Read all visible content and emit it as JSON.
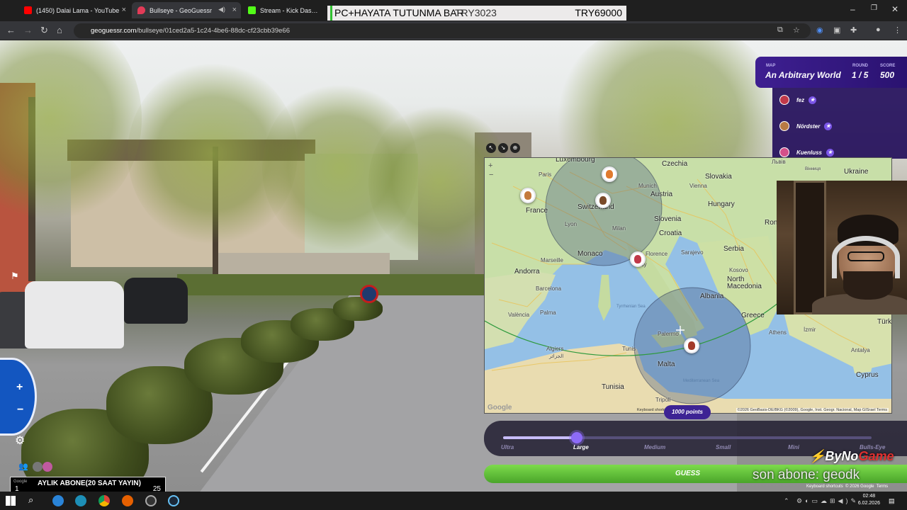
{
  "browser": {
    "tabs": [
      {
        "title": "(1450) Dalai Lama - YouTube",
        "color": "#ff0000"
      },
      {
        "title": "Bullseye - GeoGuessr",
        "color": "#e23b57"
      },
      {
        "title": "Stream - Kick Dashboard",
        "color": "#53fc18"
      }
    ],
    "url_site": "geoguessr.com",
    "url_path": "/bullseye/01ced2a5-1c24-4be6-88dc-cf23cbb39e66"
  },
  "stream_banner": {
    "left": "PC+HAYATA TUTUNMA BAR",
    "middle": "TRY3023",
    "right": "TRY69000"
  },
  "hud": {
    "map_label": "MAP",
    "map_name": "An Arbitrary World",
    "round_label": "ROUND",
    "round_value": "1 / 5",
    "score_label": "SCORE",
    "score_value": "500"
  },
  "players": [
    {
      "name": "fez",
      "avatar_color": "#c0394a"
    },
    {
      "name": "Nördster",
      "avatar_color": "#b97a44"
    },
    {
      "name": "Kuenluss",
      "avatar_color": "#d4508a"
    }
  ],
  "map": {
    "labels": {
      "luxembourg": "Luxembourg",
      "czechia": "Czechia",
      "slovakia": "Slovakia",
      "ukraine": "Ukraine",
      "lviv": "Львів",
      "vinnytsia": "Вінниця",
      "paris": "Paris",
      "munich": "Munich",
      "austria": "Austria",
      "vienna": "Vienna",
      "france": "France",
      "switzerland": "Switzerland",
      "hungary": "Hungary",
      "lyon": "Lyon",
      "milan": "Milan",
      "slovenia": "Slovenia",
      "croatia": "Croatia",
      "monaco": "Monaco",
      "sarajevo": "Sarajevo",
      "serbia": "Serbia",
      "marseille": "Marseille",
      "andorra": "Andorra",
      "florence": "Florence",
      "italy": "Italy",
      "kosovo": "Kosovo",
      "barcelona": "Barcelona",
      "north_macedonia": "North Macedonia",
      "albania": "Albania",
      "valencia": "València",
      "palma": "Palma",
      "tyrrhenian": "Tyrrhenian Sea",
      "greece": "Greece",
      "palermo": "Palermo",
      "athens": "Athens",
      "izmir": "İzmir",
      "algiers": "Algiers",
      "tunis": "Tunis",
      "antalya": "Antalya",
      "malta": "Malta",
      "tunisia": "Tunisia",
      "med_sea": "Mediterranean Sea",
      "cyprus": "Cyprus",
      "tripoli": "Tripoli",
      "turkey": "Türk",
      "romania": "Ron",
      "algiers_ar": "الجزائر"
    },
    "attribution": "©2026 GeoBasis-DE/BKG (©2009), Google, Inst. Geogr. Nacional, Map GISrael",
    "terms": "Terms",
    "keyboard": "Keyboard shortcuts",
    "watermark": "Google"
  },
  "points_badge": "1000 points",
  "sizes": {
    "options": [
      "Ultra",
      "Large",
      "Medium",
      "Small",
      "Mini",
      "Bulls-Eye"
    ],
    "selected": "Large",
    "selected_fraction": 0.2
  },
  "guess_label": "GUESS",
  "overlay": {
    "brand_prefix": "ByNo",
    "brand_suffix": "Game",
    "last_sub": "son abone: geodk",
    "sub_box_left": "1",
    "sub_box_text": "AYLIK ABONE(20 SAAT YAYIN)",
    "sub_box_right": "25",
    "sub_box_google": "Google"
  },
  "streetview_footer": {
    "keyboard": "Keyboard shortcuts",
    "copyright": "© 2026 Google",
    "terms": "Terms"
  },
  "taskbar": {
    "time": "02:48",
    "date": "6.02.2026"
  }
}
